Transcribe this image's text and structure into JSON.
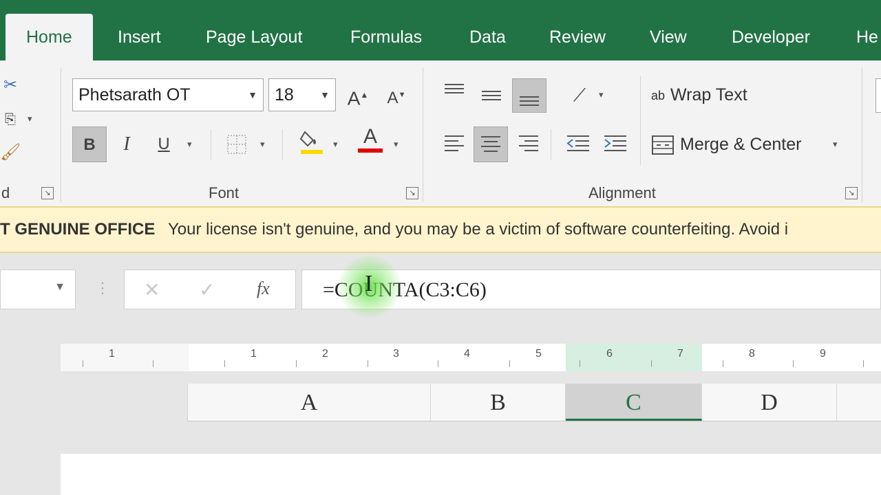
{
  "tabs": [
    "Home",
    "Insert",
    "Page Layout",
    "Formulas",
    "Data",
    "Review",
    "View",
    "Developer",
    "He"
  ],
  "ribbon": {
    "font": {
      "name": "Phetsarath OT",
      "size": "18",
      "bold": "B",
      "italic": "I",
      "underline": "U",
      "font_color_glyph": "A",
      "grow_glyph": "A",
      "shrink_glyph": "A",
      "group_label": "Font"
    },
    "clipboard_label_fragment": "d",
    "alignment": {
      "wrap_text": "Wrap Text",
      "wrap_icon_glyph": "ab",
      "merge_center": "Merge & Center",
      "group_label": "Alignment"
    },
    "colors": {
      "fill_color": "#ffd800",
      "font_color": "#e00000"
    }
  },
  "license_bar": {
    "title": "T GENUINE OFFICE",
    "message": "Your license isn't genuine, and you may be a victim of software counterfeiting. Avoid i"
  },
  "formula_bar": {
    "fx": "fx",
    "cancel": "✕",
    "enter": "✓",
    "formula": "=COUNTA(C3:C6)"
  },
  "ruler": {
    "labels": [
      "1",
      "1",
      "2",
      "3",
      "4",
      "5",
      "6",
      "7",
      "8",
      "9"
    ]
  },
  "columns": [
    "A",
    "B",
    "C",
    "D"
  ],
  "selected_column": "C",
  "accent_color": "#217346"
}
